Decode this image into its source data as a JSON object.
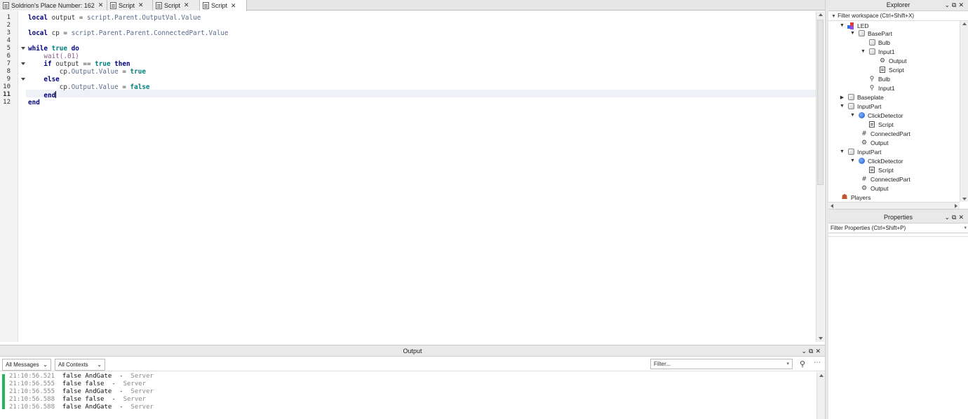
{
  "tabs": [
    {
      "label": "Soldrion's Place Number: 162",
      "icon": "place-icon",
      "active": false
    },
    {
      "label": "Script",
      "icon": "script-icon",
      "active": false
    },
    {
      "label": "Script",
      "icon": "script-icon",
      "active": false
    },
    {
      "label": "Script",
      "icon": "script-icon",
      "active": true
    }
  ],
  "tab_close": "✕",
  "editor": {
    "line_numbers": [
      "1",
      "2",
      "3",
      "4",
      "5",
      "6",
      "7",
      "8",
      "9",
      "10",
      "11",
      "12"
    ],
    "current_line": "11"
  },
  "output": {
    "title": "Output",
    "messages_filter": "All Messages",
    "contexts_filter": "All Contexts",
    "filter_placeholder": "Filter...",
    "logs": [
      {
        "time": "21:10:56.521",
        "msg": "false AndGate",
        "src": "Server"
      },
      {
        "time": "21:10:56.555",
        "msg": "false false",
        "src": "Server"
      },
      {
        "time": "21:10:56.555",
        "msg": "false AndGate",
        "src": "Server"
      },
      {
        "time": "21:10:56.588",
        "msg": "false false",
        "src": "Server"
      },
      {
        "time": "21:10:56.588",
        "msg": "false AndGate",
        "src": "Server"
      }
    ]
  },
  "explorer": {
    "title": "Explorer",
    "filter_placeholder": "Filter workspace (Ctrl+Shift+X)",
    "items": [
      {
        "label": "LED",
        "icon": "model-icon",
        "arrow": "▼",
        "depth": 1
      },
      {
        "label": "BasePart",
        "icon": "part-icon",
        "arrow": "▼",
        "depth": 2
      },
      {
        "label": "Bulb",
        "icon": "part-icon",
        "arrow": "",
        "depth": 3
      },
      {
        "label": "Input1",
        "icon": "part-icon",
        "arrow": "▼",
        "depth": 3
      },
      {
        "label": "Output",
        "icon": "bool-value-icon",
        "arrow": "",
        "depth": 4
      },
      {
        "label": "Script",
        "icon": "script-icon",
        "arrow": "",
        "depth": 4
      },
      {
        "label": "Bulb",
        "icon": "weld-icon",
        "arrow": "",
        "depth": 3
      },
      {
        "label": "Input1",
        "icon": "weld-icon",
        "arrow": "",
        "depth": 3
      },
      {
        "label": "Baseplate",
        "icon": "part-icon",
        "arrow": "▶",
        "depth": 1
      },
      {
        "label": "InputPart",
        "icon": "part-icon",
        "arrow": "▼",
        "depth": 1
      },
      {
        "label": "ClickDetector",
        "icon": "click-detector-icon",
        "arrow": "▼",
        "depth": 2
      },
      {
        "label": "Script",
        "icon": "script-icon",
        "arrow": "",
        "depth": 3
      },
      {
        "label": "ConnectedPart",
        "icon": "object-value-icon",
        "arrow": "",
        "depth": 2
      },
      {
        "label": "Output",
        "icon": "bool-value-icon",
        "arrow": "",
        "depth": 2
      },
      {
        "label": "InputPart",
        "icon": "part-icon",
        "arrow": "▼",
        "depth": 1
      },
      {
        "label": "ClickDetector",
        "icon": "click-detector-icon",
        "arrow": "▼",
        "depth": 2
      },
      {
        "label": "Script",
        "icon": "script-icon",
        "arrow": "",
        "depth": 3
      },
      {
        "label": "ConnectedPart",
        "icon": "object-value-icon",
        "arrow": "",
        "depth": 2
      },
      {
        "label": "Output",
        "icon": "bool-value-icon",
        "arrow": "",
        "depth": 2
      },
      {
        "label": "Players",
        "icon": "players-icon",
        "arrow": "",
        "depth": 0
      }
    ]
  },
  "properties": {
    "title": "Properties",
    "filter_placeholder": "Filter Properties (Ctrl+Shift+P)"
  },
  "colors": {
    "keyword": "#00007f",
    "boolean": "#007f7f",
    "log_marker": "#2ab35a"
  }
}
